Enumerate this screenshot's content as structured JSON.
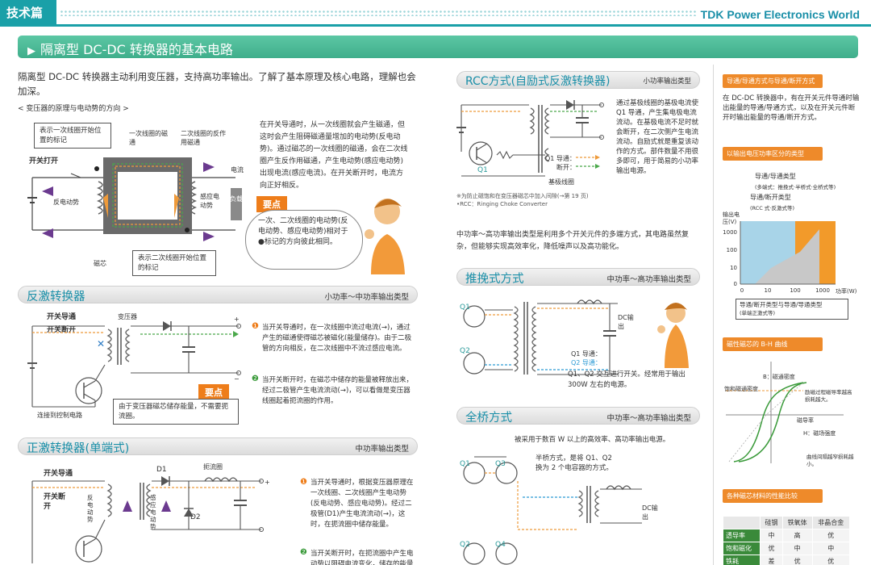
{
  "header": {
    "section_tag": "技术篇",
    "brand": "TDK Power Electronics World"
  },
  "title": {
    "arrow": "▶",
    "text": "隔离型 DC-DC 转换器的基本电路"
  },
  "intro": "隔离型 DC-DC 转换器主动利用变压器，支持高功率输出。了解了基本原理及核心电路，理解也会加深。",
  "transformer": {
    "caption": "< 变压器的原理与电动势的方向 >",
    "label_primary_start": "表示一次线圈开始位置的标记",
    "label_primary_flux": "一次线圈的磁通",
    "label_secondary_flux": "二次线圈的反作用磁通",
    "switch_on": "开关打开",
    "back_emf": "反电动势",
    "current": "电流",
    "induced_emf": "感应电动势",
    "load": "负载",
    "core": "磁芯",
    "label_secondary_start": "表示二次线圈开始位置的标记",
    "description": "在开关导通时，从一次线圈就会产生磁通，但这时会产生阻碍磁通量增加的电动势(反电动势)。通过磁芯的一次线圈的磁通，会在二次线圈产生反作用磁通，产生电动势(感应电动势)出现电流(感应电流)。在开关断开时，电流方向正好相反。",
    "key_label": "要点",
    "key_text": "一次、二次线圈的电动势(反电动势、感应电动势)相对于●标记的方向彼此相同。"
  },
  "flyback": {
    "title": "反激转换器",
    "subtitle": "小功率～中功率输出类型",
    "switch_on": "开关导通",
    "switch_off": "开关断开",
    "transformer": "变压器",
    "connect": "连接到控制电路",
    "key_label": "要点",
    "key_text": "由于变压器磁芯储存能量，不需要扼流圈。",
    "note1": "当开关导通时，在一次线圈中流过电流(→)，通过产生的磁通使得磁芯被磁化(能量储存)。由于二极管的方向相反，在二次线圈中不流过感应电流。",
    "note2": "当开关断开时，在磁芯中储存的能量被释放出来，经过二极管产生电流流动(→)，可以看做是变压器线圈起着扼流圈的作用。"
  },
  "forward": {
    "title": "正激转换器(单端式)",
    "subtitle": "中功率输出类型",
    "switch_on": "开关导通",
    "switch_off": "开关断开",
    "d1": "D1",
    "d2": "D2",
    "choke": "扼流圈",
    "back_emf": "反电动势",
    "induced_emf": "感应电动势",
    "note1": "当开关导通时，根据变压器原理在一次线圈、二次线圈产生电动势(反电动势、感应电动势)。经过二极管(D1)产生电流流动(→)，这时，在扼流圈中储存能量。",
    "note2": "当开关断开时，在扼流圈中产生电动势以阻碍电流变化，储存的能量被释放出来"
  },
  "rcc": {
    "title": "RCC方式(自励式反激转换器)",
    "subtitle": "小功率输出类型",
    "q1": "Q1",
    "legend_on": "Q1 导通：",
    "legend_off": "断开：",
    "base_coil": "基极线圈",
    "description": "通过基极线圈的基极电流使 Q1 导通，产生集电极电流流动。在基极电流不足时就会断开，在二次侧产生电流流动。自励式就是重复该动作的方式。部件数量不用很多即可，用于简易的小功率输出电源。",
    "footnote1": "※为防止磁饱和在变压器磁芯中加入间隙(→第 19 页)",
    "footnote2": "•RCC：Ringing Choke Converter"
  },
  "mid_text": "中功率～高功率输出类型是利用多个开关元件的多端方式，其电路虽然复杂，但能够实现高效率化，降低噪声以及高功能化。",
  "pushpull": {
    "title": "推挽式方式",
    "subtitle": "中功率～高功率输出类型",
    "q1": "Q1",
    "q2": "Q2",
    "dc_out": "DC输出",
    "legend_q1": "Q1 导通：",
    "legend_q2": "Q2 导通：",
    "description": "Q1、Q2 交互进行开关。经常用于输出 300W 左右的电源。"
  },
  "fullbridge": {
    "title": "全桥方式",
    "subtitle": "中功率～高功率输出类型",
    "lead": "被采用于数百 W 以上的高效率、高功率输出电源。",
    "q1": "Q1",
    "q2": "Q2",
    "q3": "Q3",
    "q4": "Q4",
    "dc_out": "DC输出",
    "halfbridge_note": "半桥方式，是将 Q1、Q2 换为 2 个电容器的方式。"
  },
  "sidebar": {
    "head1": "导通/导通方式与导通/断开方式",
    "text1": "在 DC-DC 转换器中，有在开关元件导通时输出能量的导通/导通方式，以及在开关元件断开时输出能量的导通/断开方式。",
    "head2": "以输出电压功率区分的类型",
    "chart_label_onon": "导通/导通类型",
    "chart_label_onon_sub": "(多端式：推挽式·半桥式·全桥式等)",
    "chart_label_onoff": "导通/断开类型",
    "chart_label_onoff_sub": "(RCC 式·反激式等)",
    "chart_yaxis": "输出电压(V)",
    "chart_xaxis": "功率(W)",
    "chart_mix": "导通/断开类型与导通/导通类型",
    "chart_mix_sub": "(单端正激式等)",
    "yticks": [
      "1000",
      "100",
      "10",
      "0"
    ],
    "xticks": [
      "0",
      "10",
      "100",
      "1000"
    ],
    "head3": "磁性磁芯的 B-H 曲线",
    "bh_b": "B：磁通密度",
    "bh_sat": "饱和磁通密度",
    "bh_note1": "励磁过程磁导率越高损耗越大。",
    "bh_mu": "磁导率",
    "bh_h": "H：磁场强度",
    "bh_note2": "曲线间隔越窄损耗越小。",
    "head4": "各种磁芯材料的性能比较"
  },
  "table": {
    "columns": [
      "",
      "硅钢",
      "铁氧体",
      "非晶合金"
    ],
    "rows": [
      [
        "透导率",
        "中",
        "高",
        "优"
      ],
      [
        "饱和磁化",
        "优",
        "中",
        "中"
      ],
      [
        "铁耗",
        "差",
        "优",
        "优"
      ]
    ]
  },
  "colors": {
    "teal": "#1aa0a8",
    "green": "#3fae8b",
    "orange": "#ee7d1a",
    "purple": "#6b3a8f"
  }
}
